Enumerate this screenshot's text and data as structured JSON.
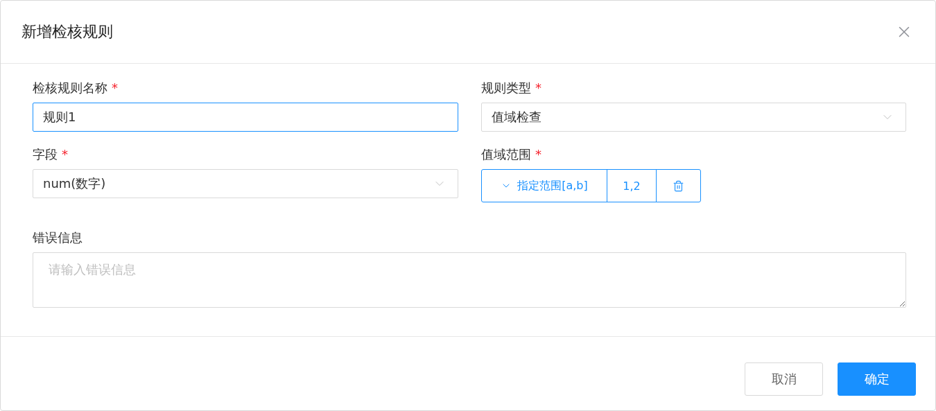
{
  "dialog": {
    "title": "新增检核规则"
  },
  "fields": [
    {
      "kind": "text",
      "label": "检核规则名称",
      "required_mark": "*",
      "value": "规则1",
      "focused": true
    },
    {
      "kind": "select",
      "label": "规则类型",
      "required_mark": "*",
      "value": "值域检查",
      "focused": false
    },
    {
      "kind": "select",
      "label": "字段",
      "required_mark": "*",
      "value": "num(数字)",
      "focused": false
    },
    {
      "kind": "range",
      "label": "值域范围",
      "required_mark": "*",
      "mode": "指定范围[a,b]",
      "value": "1,2"
    },
    {
      "kind": "textarea",
      "label": "错误信息",
      "placeholder": "请输入错误信息"
    }
  ],
  "buttons": [
    {
      "label": "取消",
      "primary": false
    },
    {
      "label": "确定",
      "primary": true
    }
  ]
}
